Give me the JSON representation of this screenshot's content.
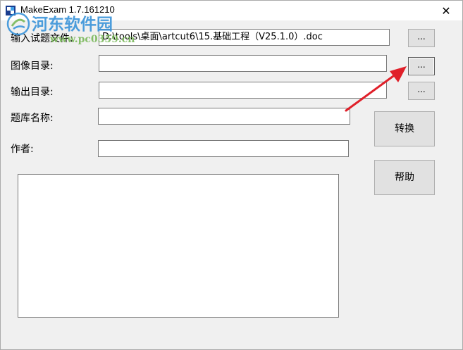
{
  "window": {
    "title": "MakeExam 1.7.161210",
    "close_glyph": "✕"
  },
  "watermark": {
    "site_name": "河东软件园",
    "url": "www.pc0359.cn"
  },
  "form": {
    "input_file": {
      "label": "输入试题文件:",
      "value": "D:\\tools\\桌面\\artcut6\\15.基础工程（V25.1.0）.doc"
    },
    "image_dir": {
      "label": "图像目录:",
      "value": ""
    },
    "output_dir": {
      "label": "输出目录:",
      "value": ""
    },
    "bank_name": {
      "label": "题库名称:",
      "value": ""
    },
    "author": {
      "label": "作者:",
      "value": ""
    },
    "browse_label": "..."
  },
  "buttons": {
    "convert": "转换",
    "help": "帮助"
  },
  "colors": {
    "window_bg": "#f0f0f0",
    "arrow": "#e0202a",
    "watermark_blue": "#2f8ed8",
    "watermark_green": "#79b85a"
  }
}
